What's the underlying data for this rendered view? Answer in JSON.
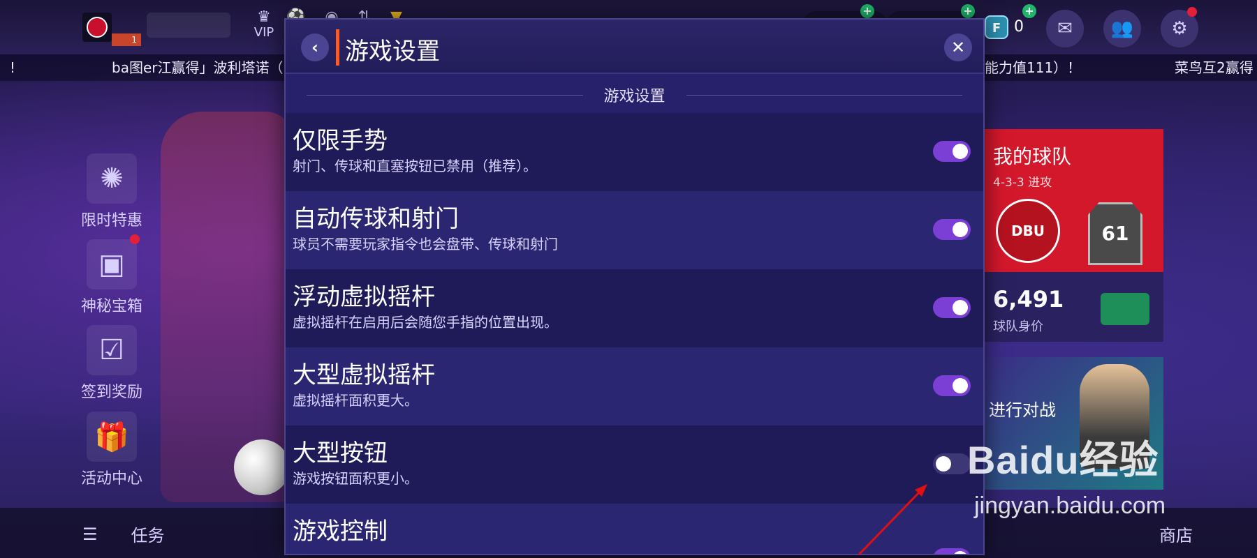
{
  "topbar": {
    "level": "1",
    "vip_label": "VIP",
    "f_currency": "0",
    "mail_icon": "mail-icon",
    "friends_icon": "friends-icon",
    "settings_icon": "gear-icon"
  },
  "ticker": {
    "left_excl": "!",
    "message_left": "ba图er江赢得」波利塔诺（",
    "message_mid": "能力值111）！",
    "message_right": "菜鸟互2赢得"
  },
  "side_menu": [
    {
      "label": "限时特惠",
      "icon": "aperture-icon"
    },
    {
      "label": "神秘宝箱",
      "icon": "treasure-chest-icon"
    },
    {
      "label": "签到奖励",
      "icon": "calendar-check-icon"
    },
    {
      "label": "活动中心",
      "icon": "gift-fifa-icon"
    }
  ],
  "team_panel": {
    "title": "我的球队",
    "formation": "4-3-3 进攻",
    "crest_text": "DBU",
    "rating": "61",
    "value": "6,491",
    "value_label": "球队身价"
  },
  "match_panel": {
    "label": "进行对战"
  },
  "bottombar": {
    "tasks_label": "任务",
    "shop_label": "商店"
  },
  "modal": {
    "title": "游戏设置",
    "section_label": "游戏设置",
    "settings": [
      {
        "title": "仅限手势",
        "desc": "射门、传球和直塞按钮已禁用（推荐）。",
        "enabled": true
      },
      {
        "title": "自动传球和射门",
        "desc": "球员不需要玩家指令也会盘带、传球和射门",
        "enabled": true
      },
      {
        "title": "浮动虚拟摇杆",
        "desc": "虚拟摇杆在启用后会随您手指的位置出现。",
        "enabled": true
      },
      {
        "title": "大型虚拟摇杆",
        "desc": "虚拟摇杆面积更大。",
        "enabled": true
      },
      {
        "title": "大型按钮",
        "desc": "游戏按钮面积更小。",
        "enabled": false
      },
      {
        "title": "游戏控制",
        "desc": "",
        "enabled": true
      }
    ]
  },
  "watermark": {
    "logo": "Baidu经验",
    "url": "jingyan.baidu.com"
  },
  "colors": {
    "toggle_on": "#7b3fd6",
    "toggle_off": "#3d3776",
    "accent": "#ff5a1f",
    "team_red": "#d4182c"
  }
}
